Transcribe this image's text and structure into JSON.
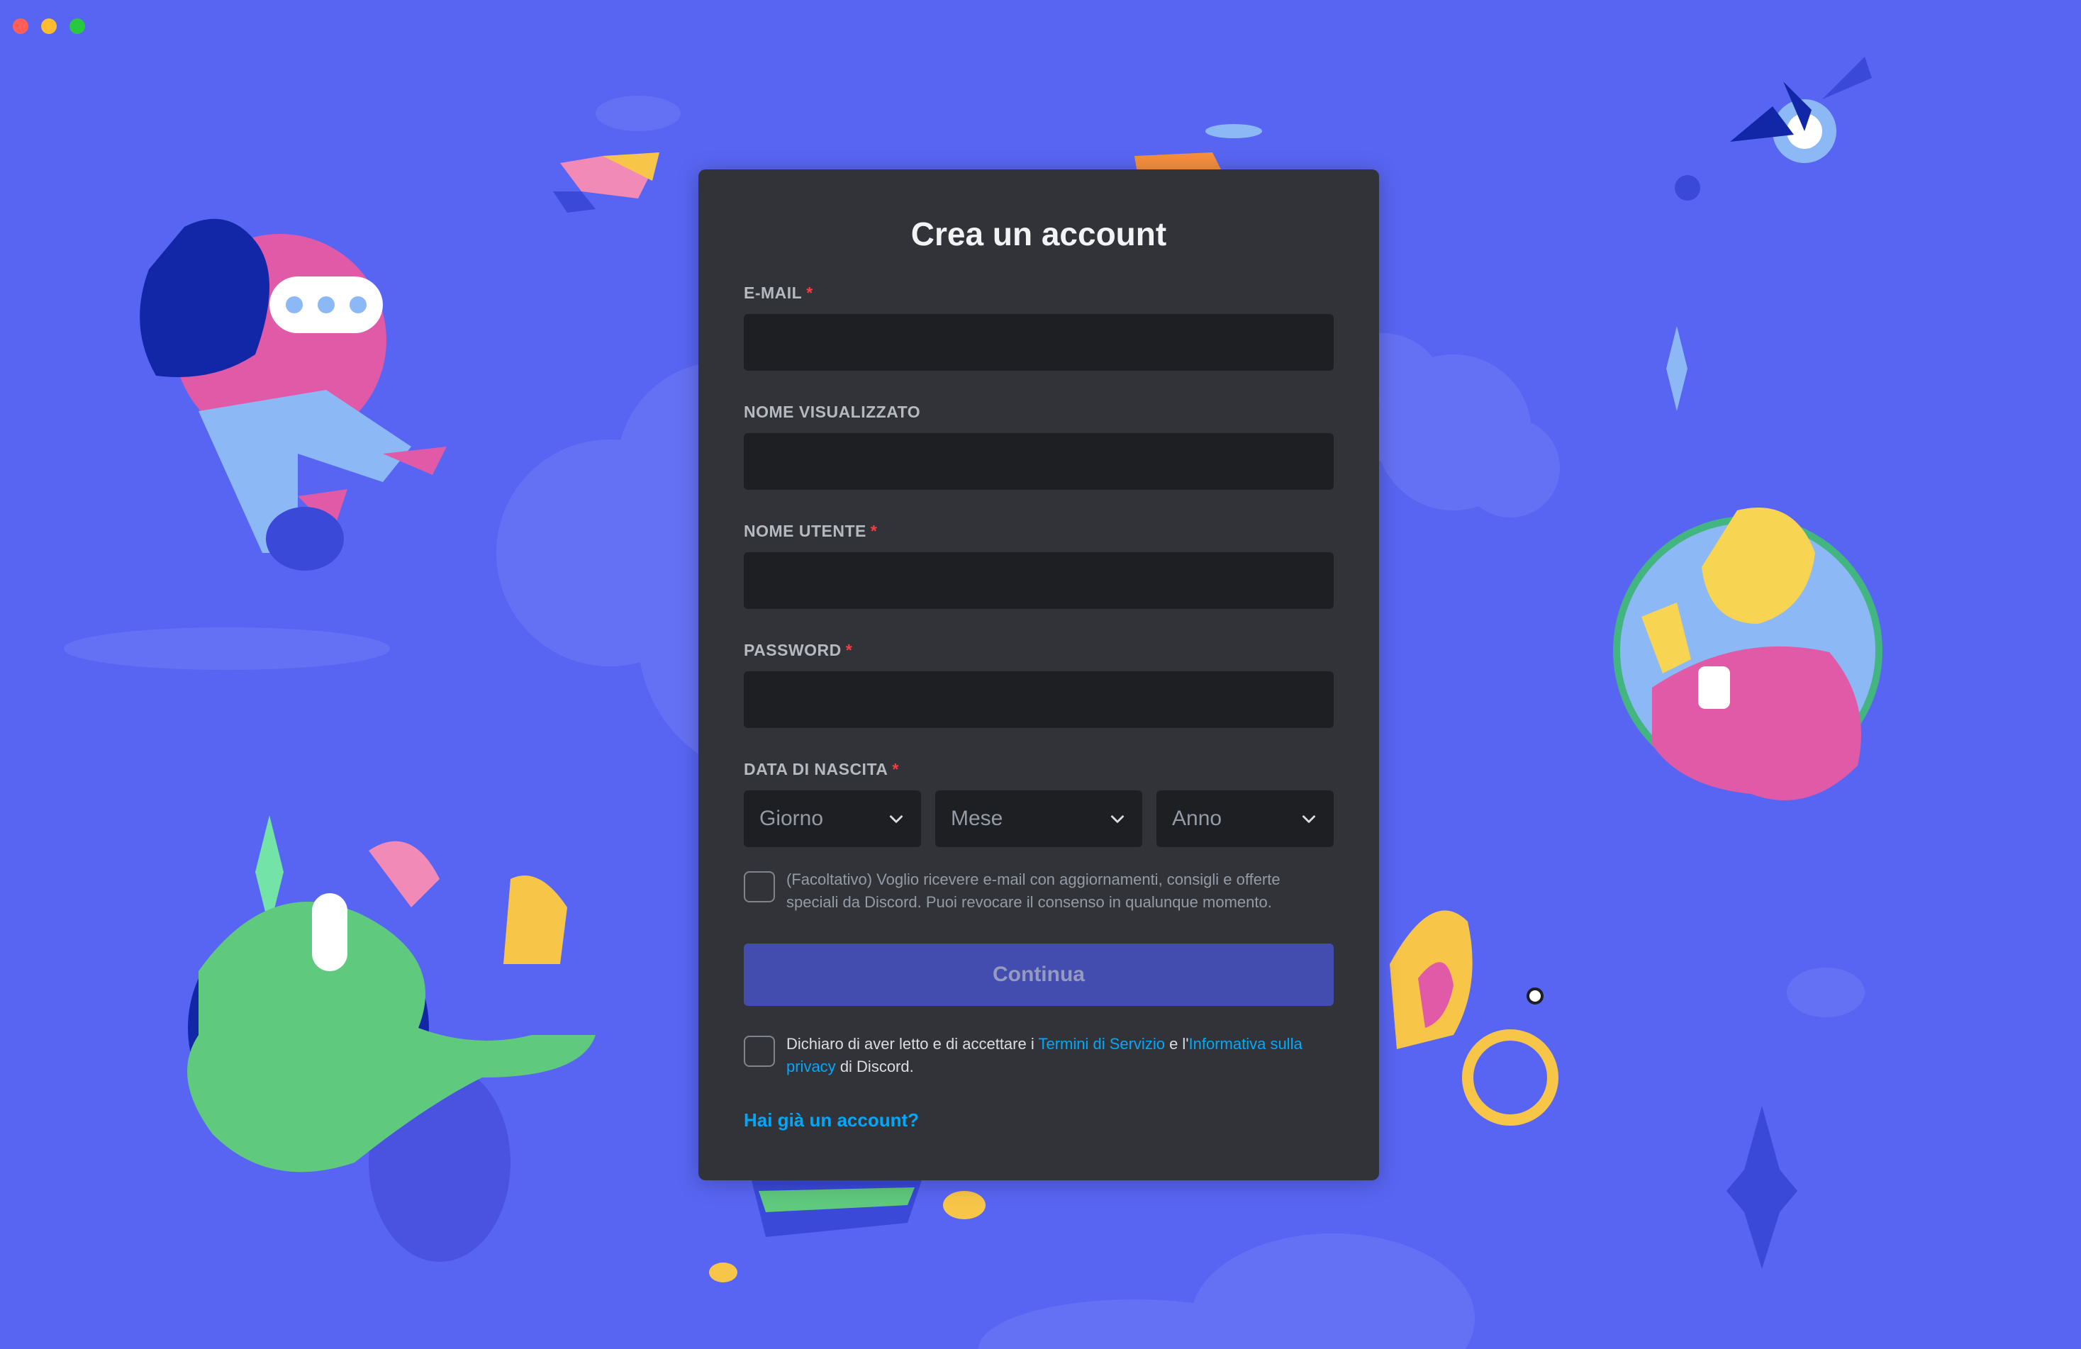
{
  "form": {
    "title": "Crea un account",
    "email_label": "E-MAIL",
    "display_name_label": "NOME VISUALIZZATO",
    "username_label": "NOME UTENTE",
    "password_label": "PASSWORD",
    "birthdate_label": "DATA DI NASCITA",
    "required_mark": "*",
    "day_select": "Giorno",
    "month_select": "Mese",
    "year_select": "Anno",
    "optin_text": "(Facoltativo) Voglio ricevere e-mail con aggiornamenti, consigli e offerte speciali da Discord. Puoi revocare il consenso in qualunque momento.",
    "continue_button": "Continua",
    "terms_prefix": "Dichiaro di aver letto e di accettare i",
    "terms_link": "Termini di Servizio",
    "terms_middle": "e l'",
    "privacy_link": "Informativa sulla privacy",
    "terms_suffix": "di Discord.",
    "login_link": "Hai già un account?"
  },
  "colors": {
    "background": "#5865f2",
    "card": "#313338",
    "input": "#1e1f22",
    "button": "#4752c4",
    "link": "#00a8fc",
    "required": "#f23f42"
  }
}
